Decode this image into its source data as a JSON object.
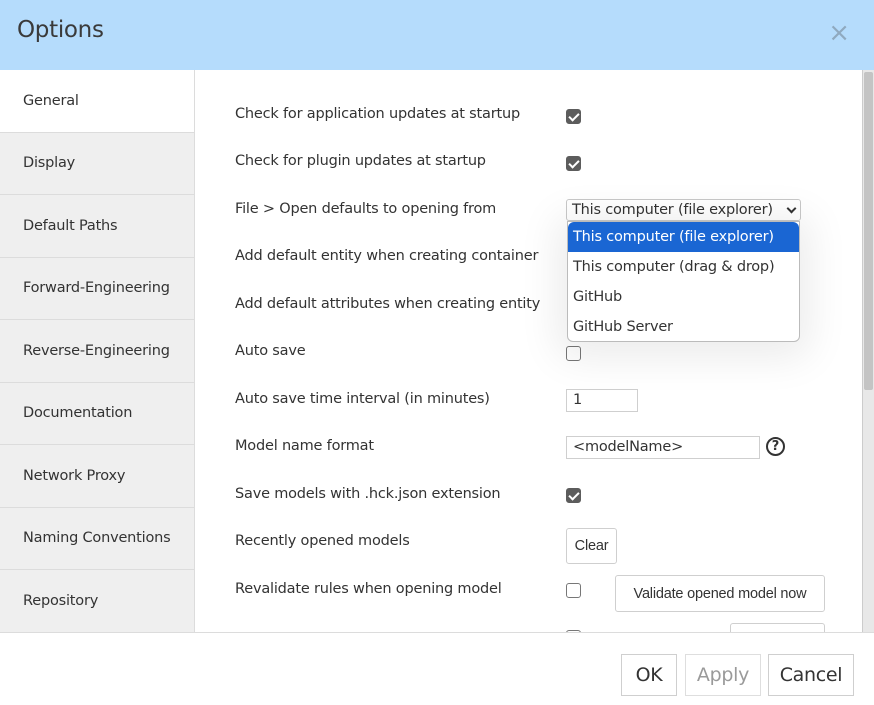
{
  "dialog": {
    "title": "Options",
    "close_icon": "×"
  },
  "sidebar": {
    "items": [
      {
        "label": "General",
        "active": true
      },
      {
        "label": "Display",
        "active": false
      },
      {
        "label": "Default Paths",
        "active": false
      },
      {
        "label": "Forward-Engineering",
        "active": false
      },
      {
        "label": "Reverse-Engineering",
        "active": false
      },
      {
        "label": "Documentation",
        "active": false
      },
      {
        "label": "Network Proxy",
        "active": false
      },
      {
        "label": "Naming Conventions",
        "active": false
      },
      {
        "label": "Repository",
        "active": false
      }
    ]
  },
  "general": {
    "check_app_updates": {
      "label": "Check for application updates at startup",
      "checked": true
    },
    "check_plugin_updates": {
      "label": "Check for plugin updates at startup",
      "checked": true
    },
    "open_defaults": {
      "label": "File > Open defaults to opening from",
      "value": "This computer (file explorer)",
      "options": [
        "This computer (file explorer)",
        "This computer (drag & drop)",
        "GitHub",
        "GitHub Server"
      ],
      "highlighted_index": 0
    },
    "add_default_entity": {
      "label": "Add default entity when creating container"
    },
    "add_default_attributes": {
      "label": "Add default attributes when creating entity"
    },
    "auto_save": {
      "label": "Auto save",
      "checked": false
    },
    "auto_save_interval": {
      "label": "Auto save time interval (in minutes)",
      "value": "1"
    },
    "model_name_format": {
      "label": "Model name format",
      "value": "<modelName>",
      "help_icon": "?"
    },
    "save_hck_json": {
      "label": "Save models with .hck.json extension",
      "checked": true
    },
    "recently_opened": {
      "label": "Recently opened models",
      "button": "Clear"
    },
    "revalidate_rules": {
      "label": "Revalidate rules when opening model",
      "checked": false,
      "button": "Validate opened model now"
    }
  },
  "footer": {
    "ok": "OK",
    "apply": "Apply",
    "cancel": "Cancel"
  }
}
